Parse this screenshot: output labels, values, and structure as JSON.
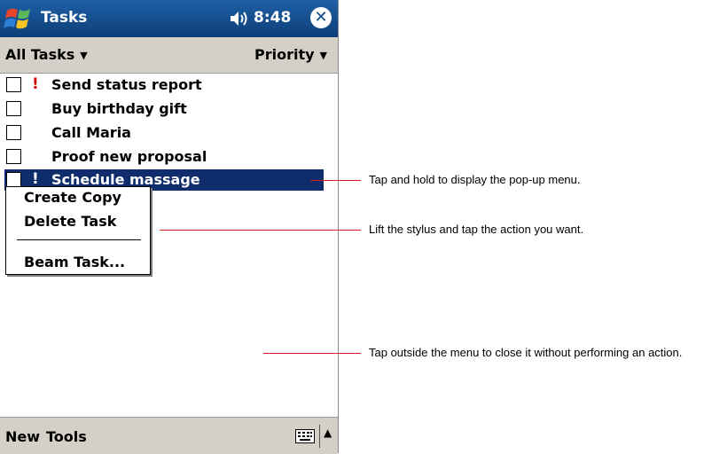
{
  "title_bar": {
    "app_title": "Tasks",
    "time": "8:48",
    "close_glyph": "✕"
  },
  "filter_bar": {
    "category_filter": "All Tasks",
    "sort_by": "Priority",
    "dropdown_glyph": "▼"
  },
  "tasks": [
    {
      "label": "Send status report",
      "priority_mark": "!",
      "checked": false
    },
    {
      "label": "Buy birthday gift",
      "priority_mark": "",
      "checked": false
    },
    {
      "label": "Call Maria",
      "priority_mark": "",
      "checked": false
    },
    {
      "label": "Proof new proposal",
      "priority_mark": "",
      "checked": false
    },
    {
      "label": "Schedule massage",
      "priority_mark": "!",
      "checked": false,
      "selected": true
    }
  ],
  "popup_menu": {
    "items": [
      "Create Copy",
      "Delete Task",
      "Beam Task..."
    ]
  },
  "menu_bar": {
    "new_label": "New",
    "tools_label": "Tools",
    "sip_arrow_glyph": "▲"
  },
  "callouts": [
    "Tap and hold to display the pop-up menu.",
    "Lift the stylus and tap the action you want.",
    "Tap outside the menu to close it without performing an action."
  ],
  "colors": {
    "title_bar": "#0e4a86",
    "toolbar": "#d4d0c8",
    "selection": "#0f2d6c",
    "high_priority": "#d00000",
    "callout_line": "#d71920"
  },
  "icons": [
    "windows-start-icon",
    "speaker-icon",
    "close-icon",
    "keyboard-icon",
    "chevron-up-icon"
  ]
}
